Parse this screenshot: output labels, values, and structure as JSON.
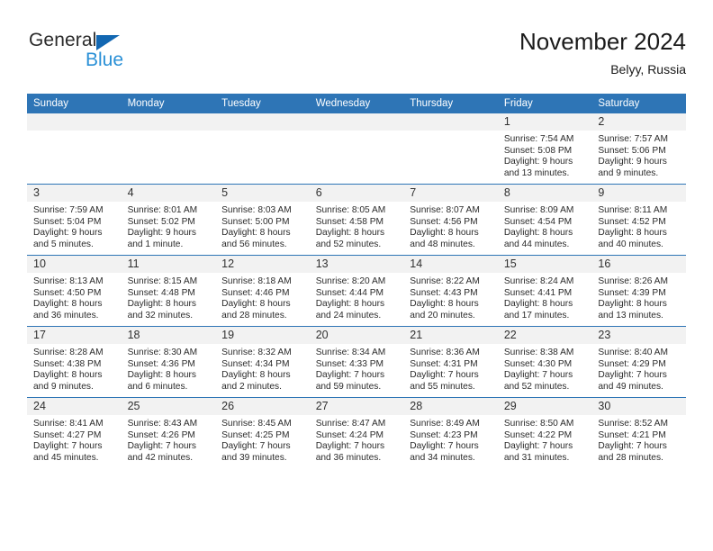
{
  "brand": {
    "name_top": "General",
    "name_bottom": "Blue",
    "triangle_color": "#1267b2",
    "blue_color": "#2a90d6"
  },
  "header": {
    "title": "November 2024",
    "subtitle": "Belyy, Russia"
  },
  "theme": {
    "header_bg": "#2e75b6",
    "header_text": "#ffffff",
    "daynum_bg": "#f2f2f2",
    "grid_line": "#2e75b6",
    "body_text": "#2b2b2b"
  },
  "weekday_headers": [
    "Sunday",
    "Monday",
    "Tuesday",
    "Wednesday",
    "Thursday",
    "Friday",
    "Saturday"
  ],
  "weeks": [
    [
      {
        "day": ""
      },
      {
        "day": ""
      },
      {
        "day": ""
      },
      {
        "day": ""
      },
      {
        "day": ""
      },
      {
        "day": "1",
        "sunrise": "Sunrise: 7:54 AM",
        "sunset": "Sunset: 5:08 PM",
        "daylight_line1": "Daylight: 9 hours",
        "daylight_line2": "and 13 minutes."
      },
      {
        "day": "2",
        "sunrise": "Sunrise: 7:57 AM",
        "sunset": "Sunset: 5:06 PM",
        "daylight_line1": "Daylight: 9 hours",
        "daylight_line2": "and 9 minutes."
      }
    ],
    [
      {
        "day": "3",
        "sunrise": "Sunrise: 7:59 AM",
        "sunset": "Sunset: 5:04 PM",
        "daylight_line1": "Daylight: 9 hours",
        "daylight_line2": "and 5 minutes."
      },
      {
        "day": "4",
        "sunrise": "Sunrise: 8:01 AM",
        "sunset": "Sunset: 5:02 PM",
        "daylight_line1": "Daylight: 9 hours",
        "daylight_line2": "and 1 minute."
      },
      {
        "day": "5",
        "sunrise": "Sunrise: 8:03 AM",
        "sunset": "Sunset: 5:00 PM",
        "daylight_line1": "Daylight: 8 hours",
        "daylight_line2": "and 56 minutes."
      },
      {
        "day": "6",
        "sunrise": "Sunrise: 8:05 AM",
        "sunset": "Sunset: 4:58 PM",
        "daylight_line1": "Daylight: 8 hours",
        "daylight_line2": "and 52 minutes."
      },
      {
        "day": "7",
        "sunrise": "Sunrise: 8:07 AM",
        "sunset": "Sunset: 4:56 PM",
        "daylight_line1": "Daylight: 8 hours",
        "daylight_line2": "and 48 minutes."
      },
      {
        "day": "8",
        "sunrise": "Sunrise: 8:09 AM",
        "sunset": "Sunset: 4:54 PM",
        "daylight_line1": "Daylight: 8 hours",
        "daylight_line2": "and 44 minutes."
      },
      {
        "day": "9",
        "sunrise": "Sunrise: 8:11 AM",
        "sunset": "Sunset: 4:52 PM",
        "daylight_line1": "Daylight: 8 hours",
        "daylight_line2": "and 40 minutes."
      }
    ],
    [
      {
        "day": "10",
        "sunrise": "Sunrise: 8:13 AM",
        "sunset": "Sunset: 4:50 PM",
        "daylight_line1": "Daylight: 8 hours",
        "daylight_line2": "and 36 minutes."
      },
      {
        "day": "11",
        "sunrise": "Sunrise: 8:15 AM",
        "sunset": "Sunset: 4:48 PM",
        "daylight_line1": "Daylight: 8 hours",
        "daylight_line2": "and 32 minutes."
      },
      {
        "day": "12",
        "sunrise": "Sunrise: 8:18 AM",
        "sunset": "Sunset: 4:46 PM",
        "daylight_line1": "Daylight: 8 hours",
        "daylight_line2": "and 28 minutes."
      },
      {
        "day": "13",
        "sunrise": "Sunrise: 8:20 AM",
        "sunset": "Sunset: 4:44 PM",
        "daylight_line1": "Daylight: 8 hours",
        "daylight_line2": "and 24 minutes."
      },
      {
        "day": "14",
        "sunrise": "Sunrise: 8:22 AM",
        "sunset": "Sunset: 4:43 PM",
        "daylight_line1": "Daylight: 8 hours",
        "daylight_line2": "and 20 minutes."
      },
      {
        "day": "15",
        "sunrise": "Sunrise: 8:24 AM",
        "sunset": "Sunset: 4:41 PM",
        "daylight_line1": "Daylight: 8 hours",
        "daylight_line2": "and 17 minutes."
      },
      {
        "day": "16",
        "sunrise": "Sunrise: 8:26 AM",
        "sunset": "Sunset: 4:39 PM",
        "daylight_line1": "Daylight: 8 hours",
        "daylight_line2": "and 13 minutes."
      }
    ],
    [
      {
        "day": "17",
        "sunrise": "Sunrise: 8:28 AM",
        "sunset": "Sunset: 4:38 PM",
        "daylight_line1": "Daylight: 8 hours",
        "daylight_line2": "and 9 minutes."
      },
      {
        "day": "18",
        "sunrise": "Sunrise: 8:30 AM",
        "sunset": "Sunset: 4:36 PM",
        "daylight_line1": "Daylight: 8 hours",
        "daylight_line2": "and 6 minutes."
      },
      {
        "day": "19",
        "sunrise": "Sunrise: 8:32 AM",
        "sunset": "Sunset: 4:34 PM",
        "daylight_line1": "Daylight: 8 hours",
        "daylight_line2": "and 2 minutes."
      },
      {
        "day": "20",
        "sunrise": "Sunrise: 8:34 AM",
        "sunset": "Sunset: 4:33 PM",
        "daylight_line1": "Daylight: 7 hours",
        "daylight_line2": "and 59 minutes."
      },
      {
        "day": "21",
        "sunrise": "Sunrise: 8:36 AM",
        "sunset": "Sunset: 4:31 PM",
        "daylight_line1": "Daylight: 7 hours",
        "daylight_line2": "and 55 minutes."
      },
      {
        "day": "22",
        "sunrise": "Sunrise: 8:38 AM",
        "sunset": "Sunset: 4:30 PM",
        "daylight_line1": "Daylight: 7 hours",
        "daylight_line2": "and 52 minutes."
      },
      {
        "day": "23",
        "sunrise": "Sunrise: 8:40 AM",
        "sunset": "Sunset: 4:29 PM",
        "daylight_line1": "Daylight: 7 hours",
        "daylight_line2": "and 49 minutes."
      }
    ],
    [
      {
        "day": "24",
        "sunrise": "Sunrise: 8:41 AM",
        "sunset": "Sunset: 4:27 PM",
        "daylight_line1": "Daylight: 7 hours",
        "daylight_line2": "and 45 minutes."
      },
      {
        "day": "25",
        "sunrise": "Sunrise: 8:43 AM",
        "sunset": "Sunset: 4:26 PM",
        "daylight_line1": "Daylight: 7 hours",
        "daylight_line2": "and 42 minutes."
      },
      {
        "day": "26",
        "sunrise": "Sunrise: 8:45 AM",
        "sunset": "Sunset: 4:25 PM",
        "daylight_line1": "Daylight: 7 hours",
        "daylight_line2": "and 39 minutes."
      },
      {
        "day": "27",
        "sunrise": "Sunrise: 8:47 AM",
        "sunset": "Sunset: 4:24 PM",
        "daylight_line1": "Daylight: 7 hours",
        "daylight_line2": "and 36 minutes."
      },
      {
        "day": "28",
        "sunrise": "Sunrise: 8:49 AM",
        "sunset": "Sunset: 4:23 PM",
        "daylight_line1": "Daylight: 7 hours",
        "daylight_line2": "and 34 minutes."
      },
      {
        "day": "29",
        "sunrise": "Sunrise: 8:50 AM",
        "sunset": "Sunset: 4:22 PM",
        "daylight_line1": "Daylight: 7 hours",
        "daylight_line2": "and 31 minutes."
      },
      {
        "day": "30",
        "sunrise": "Sunrise: 8:52 AM",
        "sunset": "Sunset: 4:21 PM",
        "daylight_line1": "Daylight: 7 hours",
        "daylight_line2": "and 28 minutes."
      }
    ]
  ]
}
